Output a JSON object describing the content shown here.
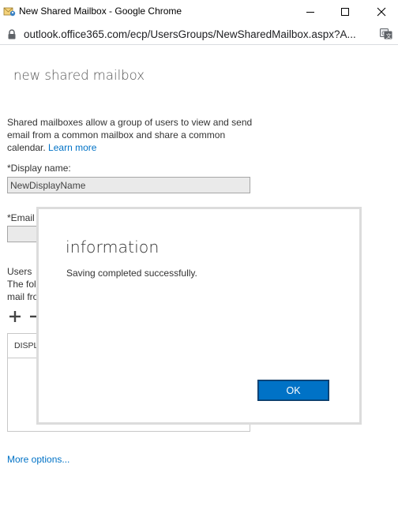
{
  "window": {
    "title": "New Shared Mailbox - Google Chrome",
    "controls": {
      "minimize": "minimize-icon",
      "maximize": "maximize-icon",
      "close": "close-icon"
    }
  },
  "address_bar": {
    "url": "outlook.office365.com/ecp/UsersGroups/NewSharedMailbox.aspx?A..."
  },
  "page": {
    "title": "new shared mailbox",
    "intro_text": "Shared mailboxes allow a group of users to view and send email from a common mailbox and share a common calendar.",
    "learn_more_link": "Learn more",
    "display_name_label": "*Display name:",
    "display_name_value": "NewDisplayName",
    "email_label": "*Email",
    "email_value": "",
    "users_label": "Users",
    "users_desc_line1": "The fol",
    "users_desc_line2": "mail fro",
    "users_table_header": "DISPL",
    "more_options_link": "More options..."
  },
  "dialog": {
    "title": "information",
    "message": "Saving completed successfully.",
    "ok_label": "OK"
  },
  "colors": {
    "accent": "#0072c6",
    "dialog_border": "#dcdcdc",
    "input_background": "#eaeaea"
  }
}
